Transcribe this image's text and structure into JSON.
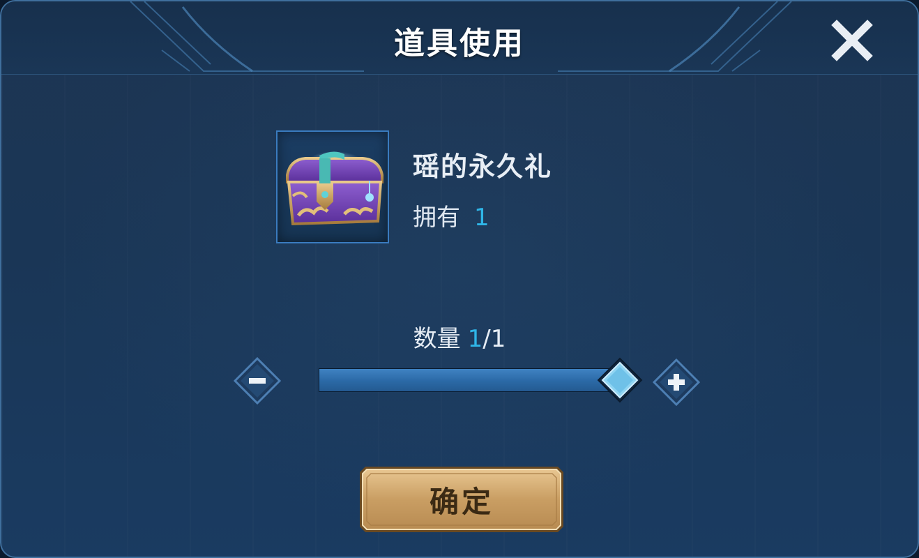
{
  "dialog": {
    "title": "道具使用",
    "close_icon": "close-x-icon"
  },
  "item": {
    "icon": "treasure-chest-icon",
    "name": "瑶的永久礼",
    "owned_label": "拥有",
    "owned_count": "1"
  },
  "quantity": {
    "label": "数量",
    "current": "1",
    "max_text": "/1",
    "fill_fraction": 1.0,
    "decrease_icon": "minus-icon",
    "increase_icon": "plus-icon"
  },
  "confirm": {
    "label": "确定"
  },
  "colors": {
    "accent": "#2fb6e8",
    "panel": "#1a3656",
    "button_gold": "#c9a067"
  }
}
